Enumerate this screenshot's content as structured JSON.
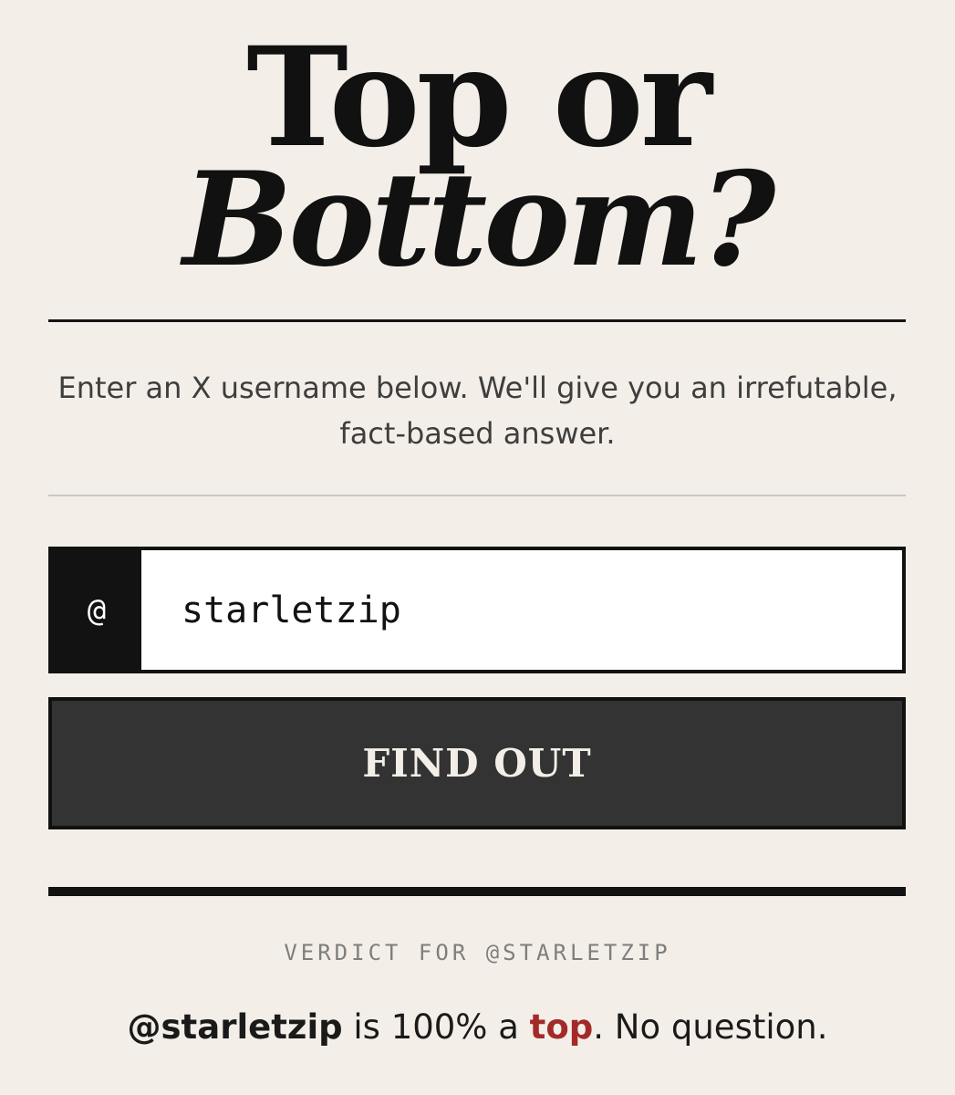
{
  "header": {
    "title_line1": "Top or",
    "title_line2": "Bottom?"
  },
  "intro": {
    "line1": "Enter an X username below. We'll give you an irrefutable,",
    "line2": "fact-based answer."
  },
  "form": {
    "prefix": "@",
    "username_value": "starletzip",
    "button_label": "FIND OUT"
  },
  "verdict": {
    "label": "VERDICT FOR @STARLETZIP",
    "handle": "@starletzip",
    "text_before_result": " is 100% a ",
    "result": "top",
    "text_after_result": ". No question."
  },
  "colors": {
    "background": "#f3efe8",
    "ink": "#121212",
    "button": "#333333",
    "result_accent": "#a42a2a"
  }
}
